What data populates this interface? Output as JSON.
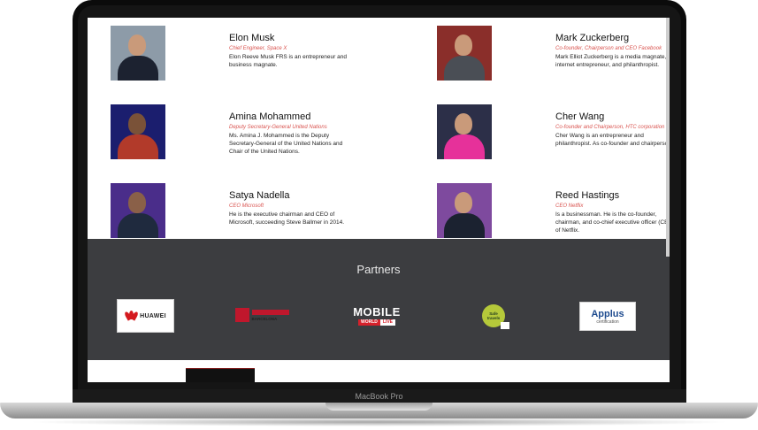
{
  "device": {
    "label": "MacBook Pro"
  },
  "speakers": [
    {
      "name": "Elon Musk",
      "role": "Chief Engineer, Space X",
      "description": "Elon Reeve Musk FRS is an entrepreneur and business magnate.",
      "photo_bg": "#8d9ba8",
      "suit": "#1c2230"
    },
    {
      "name": "Mark Zuckerberg",
      "role": "Co-founder, Chairperson and CEO Facebook",
      "description": "Mark Elliot Zuckerberg is a media magnate, internet entrepreneur, and philanthropist.",
      "photo_bg": "#8a2e2a",
      "suit": "#4a4e55"
    },
    {
      "name": "Amina Mohammed",
      "role": "Deputy Secretary-General United Nations",
      "description": "Ms. Amina J. Mohammed is the Deputy Secretary-General of the United Nations and Chair of the United Nations.",
      "photo_bg": "#1b1e6e",
      "suit": "#b23a2a"
    },
    {
      "name": "Cher Wang",
      "role": "Co-founder and Chairperson, HTC corporation",
      "description": "Cher Wang is an entrepreneur and philanthropist. As co-founder and chairperson.",
      "photo_bg": "#2c2f48",
      "suit": "#e6319a"
    },
    {
      "name": "Satya Nadella",
      "role": "CEO Microsoft",
      "description": "He is the executive chairman and CEO of Microsoft, succeeding Steve Ballmer in 2014.",
      "photo_bg": "#4a2d8a",
      "suit": "#1f2a3e"
    },
    {
      "name": "Reed Hastings",
      "role": "CEO Netflix",
      "description": "Is a businessman. He is the co-founder, chairman, and co-chief executive officer (CEO) of Netflix.",
      "photo_bg": "#7e4a9e",
      "suit": "#1b2230"
    }
  ],
  "partners": {
    "title": "Partners",
    "logos": [
      {
        "name": "HUAWEI",
        "text": "HUAWEI"
      },
      {
        "name": "Mobile World Capital Barcelona",
        "text": "BARCELONA"
      },
      {
        "name": "Mobile World Live",
        "text_main": "MOBILE",
        "text_a": "WORLD",
        "text_b": "LIVE"
      },
      {
        "name": "Safe travels",
        "text_a": "Safe",
        "text_b": "travels"
      },
      {
        "name": "Applus certification",
        "text_main": "Applus",
        "text_sub": "certification"
      }
    ]
  },
  "colors": {
    "partners_bg": "#3c3d40",
    "role_text": "#d9534f"
  }
}
